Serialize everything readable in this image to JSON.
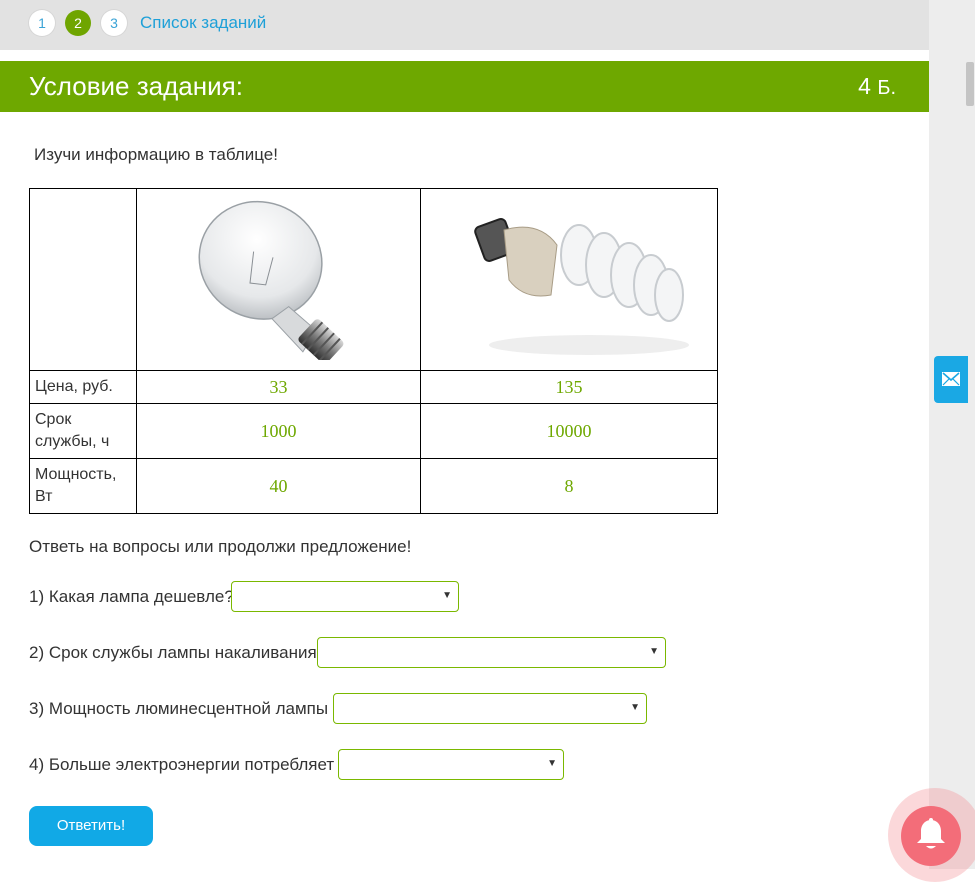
{
  "steps": [
    "1",
    "2",
    "3"
  ],
  "active_step": 2,
  "task_list_link": "Список заданий",
  "header": {
    "title": "Условие задания:",
    "points": "4",
    "points_unit": "Б."
  },
  "intro": "Изучи информацию в таблице!",
  "table": {
    "rows": [
      {
        "label": "Цена, руб.",
        "incandescent": "33",
        "fluorescent": "135"
      },
      {
        "label": "Срок службы, ч",
        "incandescent": "1000",
        "fluorescent": "10000"
      },
      {
        "label": "Мощность, Вт",
        "incandescent": "40",
        "fluorescent": "8"
      }
    ],
    "images": [
      "incandescent-bulb-image",
      "fluorescent-bulb-image"
    ]
  },
  "prompt": "Ответь на вопросы или продолжи предложение!",
  "questions": [
    {
      "text": "1) Какая лампа дешевле?",
      "selected": ""
    },
    {
      "text": "2) Срок службы лампы накаливания",
      "selected": ""
    },
    {
      "text": "3) Мощность люминесцентной лампы",
      "selected": ""
    },
    {
      "text": "4) Больше электроэнергии потребляет",
      "selected": ""
    }
  ],
  "submit_label": "Ответить!",
  "colors": {
    "brand_green": "#6ea800",
    "link_blue": "#1ea0d8",
    "button_blue": "#11a9e6",
    "bell_pink": "#f36d79"
  },
  "icons": [
    "mail-icon",
    "bell-icon",
    "dropdown-arrow-icon"
  ]
}
